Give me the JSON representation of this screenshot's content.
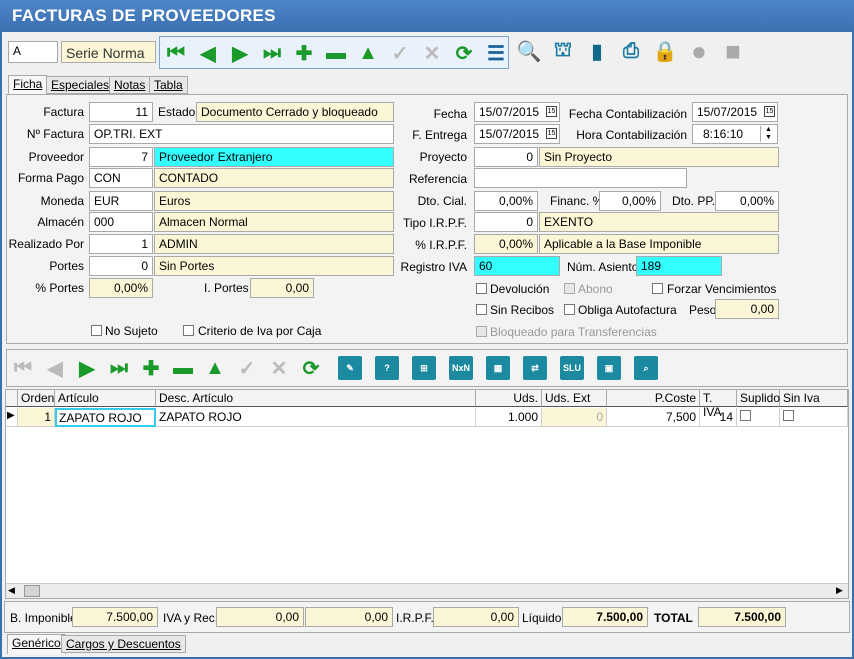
{
  "window": {
    "title": "FACTURAS DE PROVEEDORES"
  },
  "top": {
    "serie_code": "A",
    "serie_name": "Serie Norma"
  },
  "tabs": [
    {
      "label": "Ficha"
    },
    {
      "label": "Especiales"
    },
    {
      "label": "Notas"
    },
    {
      "label": "Tabla"
    }
  ],
  "form": {
    "factura_label": "Factura",
    "factura": "11",
    "estado_label": "Estado",
    "estado": "Documento Cerrado y bloqueado",
    "nfactura_label": "Nº Factura",
    "nfactura": "OP.TRI. EXT",
    "proveedor_label": "Proveedor",
    "proveedor_code": "7",
    "proveedor_name": "Proveedor Extranjero",
    "formapago_label": "Forma Pago",
    "formapago_code": "CON",
    "formapago_name": "CONTADO",
    "moneda_label": "Moneda",
    "moneda_code": "EUR",
    "moneda_name": "Euros",
    "almacen_label": "Almacén",
    "almacen_code": "000",
    "almacen_name": "Almacen Normal",
    "realizado_label": "Realizado Por",
    "realizado_code": "1",
    "realizado_name": "ADMIN",
    "portes_label": "Portes",
    "portes_code": "0",
    "portes_name": "Sin Portes",
    "pportes_label": "% Portes",
    "pportes": "0,00%",
    "iportes_label": "I. Portes",
    "iportes": "0,00",
    "nosujeto_label": "No Sujeto",
    "criterio_label": "Criterio de Iva por Caja",
    "fecha_label": "Fecha",
    "fecha": "15/07/2015",
    "fentrega_label": "F. Entrega",
    "fentrega": "15/07/2015",
    "fcontab_label": "Fecha Contabilización",
    "fcontab": "15/07/2015",
    "hcontab_label": "Hora Contabilización",
    "hcontab": "8:16:10",
    "proyecto_label": "Proyecto",
    "proyecto_code": "0",
    "proyecto_name": "Sin Proyecto",
    "referencia_label": "Referencia",
    "referencia": "",
    "dtocial_label": "Dto. Cial.",
    "dtocial": "0,00%",
    "financ_label": "Financ. %",
    "financ": "0,00%",
    "dtopp_label": "Dto. PP.",
    "dtopp": "0,00%",
    "tipoirpf_label": "Tipo I.R.P.F.",
    "tipoirpf_code": "0",
    "tipoirpf_name": "EXENTO",
    "pirpf_label": "% I.R.P.F.",
    "pirpf": "0,00%",
    "pirpf_name": "Aplicable a la Base Imponible",
    "registroiva_label": "Registro IVA",
    "registroiva": "60",
    "asiento_label": "Núm. Asiento",
    "asiento": "189",
    "devolucion_label": "Devolución",
    "abono_label": "Abono",
    "forzar_label": "Forzar Vencimientos",
    "sinrecibos_label": "Sin Recibos",
    "obliga_label": "Obliga Autofactura",
    "peso_label": "Peso",
    "peso": "0,00",
    "bloqueado_label": "Bloqueado para Transferencias"
  },
  "grid": {
    "columns": [
      "Orden",
      "Artículo",
      "Desc. Artículo",
      "Uds.",
      "Uds. Ext",
      "P.Coste",
      "T. IVA",
      "Suplido",
      "Sin Iva"
    ],
    "rows": [
      {
        "orden": "1",
        "articulo": "ZAPATO ROJO",
        "desc": "ZAPATO ROJO",
        "uds": "1.000",
        "udsext": "0",
        "pcoste": "7,500",
        "tiva": "14"
      }
    ]
  },
  "totals": {
    "base_label": "B. Imponible",
    "base": "7.500,00",
    "iva_label": "IVA y Rec.",
    "iva": "0,00",
    "rec": "0,00",
    "irpf_label": "I.R.P.F.",
    "irpf": "0,00",
    "liquido_label": "Líquido",
    "liquido": "7.500,00",
    "total_label": "TOTAL",
    "total": "7.500,00"
  },
  "bottom_tabs": [
    {
      "label": "Genérico"
    },
    {
      "label": "Cargos y Descuentos"
    }
  ]
}
